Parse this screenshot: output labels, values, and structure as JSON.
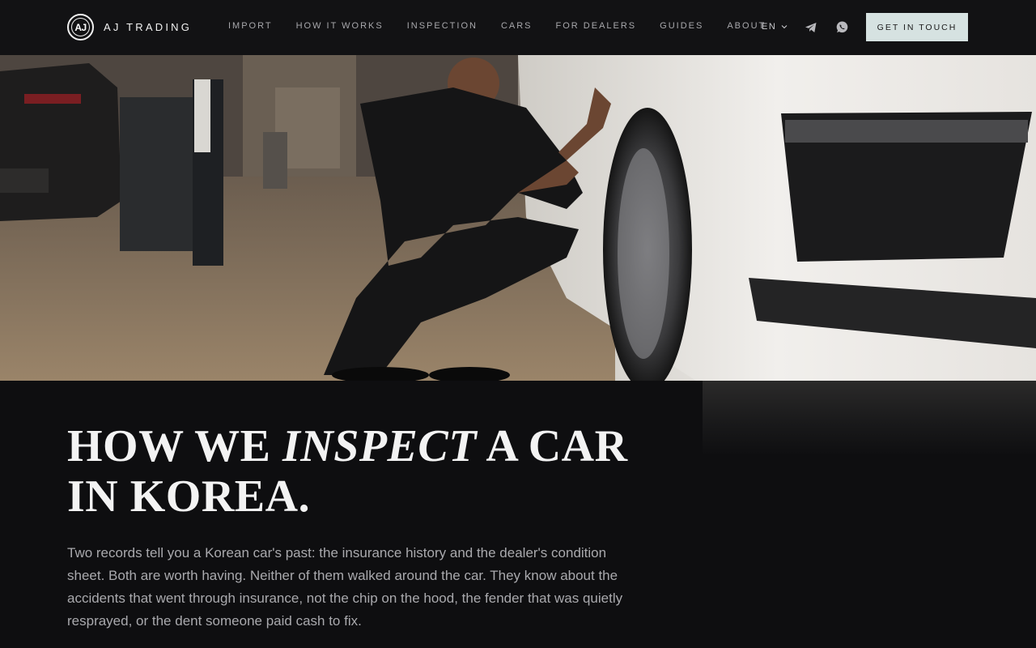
{
  "header": {
    "logo_mark": "AJ",
    "brand": "AJ TRADING",
    "nav": [
      "IMPORT",
      "HOW IT WORKS",
      "INSPECTION",
      "CARS",
      "FOR DEALERS",
      "GUIDES",
      "ABOUT"
    ],
    "language": "EN",
    "cta_label": "GET IN TOUCH"
  },
  "hero": {
    "image_icon": "mechanic-inspecting-white-car-photo"
  },
  "main": {
    "title_pre": "HOW WE ",
    "title_em": "INSPECT",
    "title_post": " A CAR IN KOREA.",
    "lead": "Two records tell you a Korean car's past: the insurance history and the dealer's condition sheet. Both are worth having. Neither of them walked around the car. They know about the accidents that went through insurance, not the chip on the hood, the fender that was quietly resprayed, or the dent someone paid cash to fix."
  },
  "colors": {
    "background": "#0e0e10",
    "header": "#121214",
    "cta_bg": "#d6e2e1",
    "nav_text": "#a8a8ac",
    "lead_text": "#a9a9ad"
  }
}
